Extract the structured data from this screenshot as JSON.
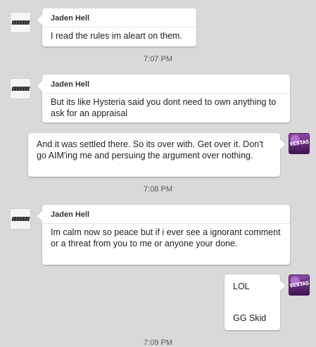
{
  "messages": [
    {
      "sender": "Jaden Hell",
      "text": "I read the rules im aleart on them."
    },
    {
      "sender": "Jaden Hell",
      "text": "But its like Hysteria said you dont need to own anything to ask for an appraisal"
    },
    {
      "text": "And it was settled there. So its over with. Get over it. Don't go AIM'ing me and persuing the argument over nothing."
    },
    {
      "sender": "Jaden Hell",
      "text": "Im calm now so peace but if i ever see a ignorant comment or a threat from you to me or anyone your done."
    },
    {
      "text_line1": "LOL",
      "text_line2": "GG Skid"
    }
  ],
  "timestamps": [
    "7:07 PM",
    "7:08 PM",
    "7:09 PM"
  ],
  "avatars": {
    "left": "brand-logo-avatar",
    "right": "purple-ecstasy-avatar",
    "right_label": "ECSTASY"
  },
  "colors": {
    "background": "#d8d9d8",
    "bubble": "#ffffff"
  }
}
